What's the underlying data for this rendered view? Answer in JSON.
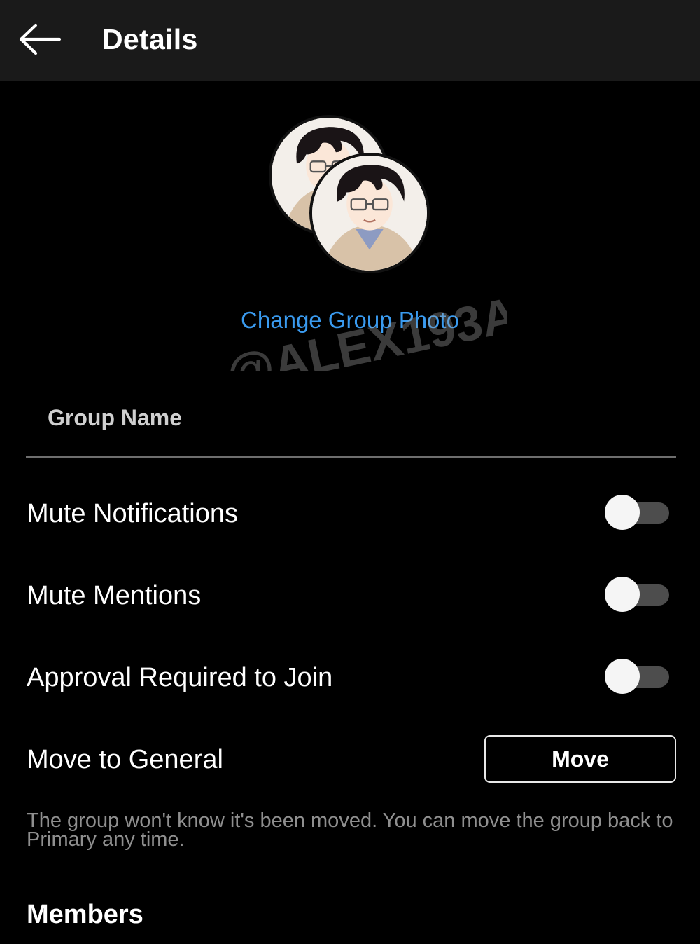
{
  "header": {
    "title": "Details",
    "back_icon": "arrow-left-icon"
  },
  "group_photo": {
    "change_label": "Change Group Photo",
    "accent_color": "#3a9bf0"
  },
  "watermark": "@ALEX193A",
  "group_name": {
    "label": "Group Name"
  },
  "settings": {
    "mute_notifications": {
      "label": "Mute Notifications",
      "enabled": false
    },
    "mute_mentions": {
      "label": "Mute Mentions",
      "enabled": false
    },
    "approval_required": {
      "label": "Approval Required to Join",
      "enabled": false
    },
    "move_to_general": {
      "label": "Move to General",
      "button_label": "Move"
    }
  },
  "helper_text": "The group won't know it's been moved. You can move the group back to Primary any time.",
  "members": {
    "title": "Members"
  }
}
